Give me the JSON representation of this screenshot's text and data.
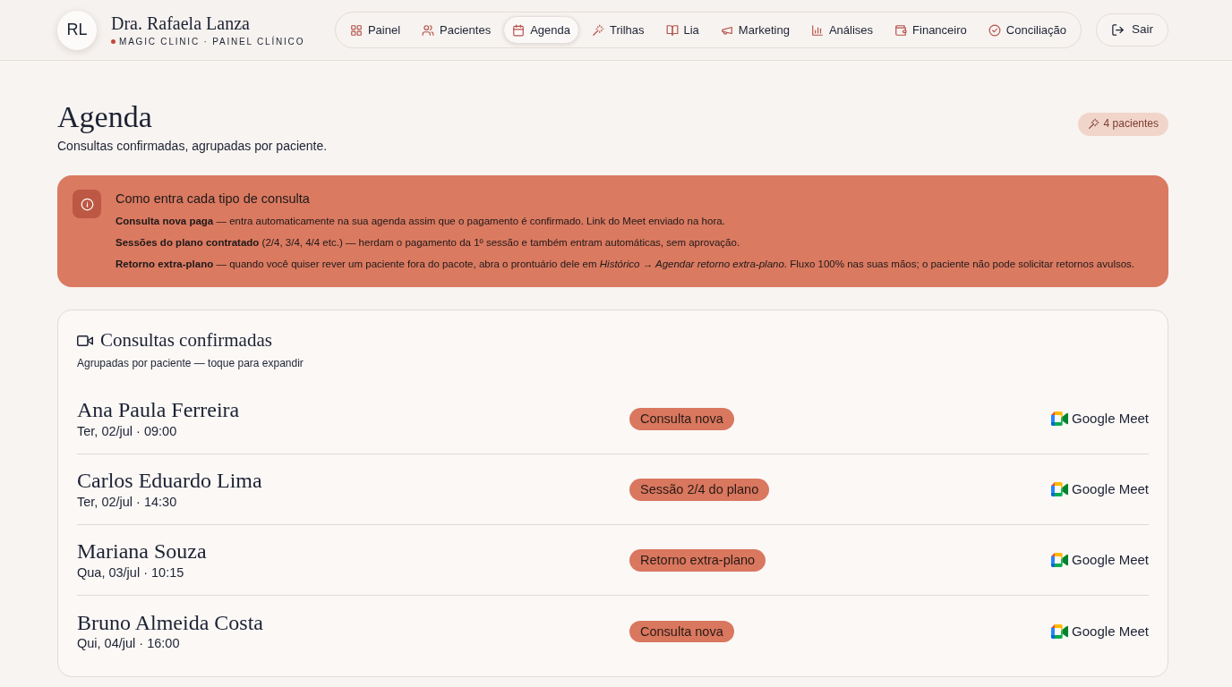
{
  "header": {
    "avatar_initials": "RL",
    "doctor_name": "Dra. Rafaela Lanza",
    "clinic_label": "MAGIC CLINIC · PAINEL CLÍNICO"
  },
  "nav": [
    {
      "label": "Painel",
      "selected": false
    },
    {
      "label": "Pacientes",
      "selected": false
    },
    {
      "label": "Agenda",
      "selected": true
    },
    {
      "label": "Trilhas",
      "selected": false
    },
    {
      "label": "Lia",
      "selected": false
    },
    {
      "label": "Marketing",
      "selected": false
    },
    {
      "label": "Análises",
      "selected": false
    },
    {
      "label": "Financeiro",
      "selected": false
    },
    {
      "label": "Conciliação",
      "selected": false
    }
  ],
  "logout": {
    "label": "Sair"
  },
  "page": {
    "title": "Agenda",
    "subtitle": "Consultas confirmadas, agrupadas por paciente.",
    "count_badge": "4 pacientes"
  },
  "info": {
    "title": "Como entra cada tipo de consulta",
    "lines": [
      "**Consulta nova paga** — entra automaticamente na sua agenda assim que o pagamento é confirmado. Link do Meet enviado na hora.",
      "**Sessões do plano contratado** (2/4, 3/4, 4/4 etc.) — herdam o pagamento da 1º sessão e também entram automáticas, sem aprovação.",
      "**Retorno extra-plano** — quando você quiser rever um paciente fora do pacote, abra o prontuário dele em *Histórico → Agendar retorno extra-plano*. Fluxo 100% nas suas mãos; o paciente não pode solicitar retornos avulsos."
    ]
  },
  "appointments": {
    "title": "Consultas confirmadas",
    "subtitle": "Agrupadas por paciente — toque para expandir",
    "rows": [
      {
        "patient": "Ana Paula Ferreira",
        "datetime": "Ter, 02/jul · 09:00",
        "tag": "Consulta nova",
        "platform": "Google Meet"
      },
      {
        "patient": "Carlos Eduardo Lima",
        "datetime": "Ter, 02/jul · 14:30",
        "tag": "Sessão 2/4 do plano",
        "platform": "Google Meet"
      },
      {
        "patient": "Mariana Souza",
        "datetime": "Qua, 03/jul · 10:15",
        "tag": "Retorno extra-plano",
        "platform": "Google Meet"
      },
      {
        "patient": "Bruno Almeida Costa",
        "datetime": "Qui, 04/jul · 16:00",
        "tag": "Consulta nova",
        "platform": "Google Meet"
      }
    ]
  }
}
